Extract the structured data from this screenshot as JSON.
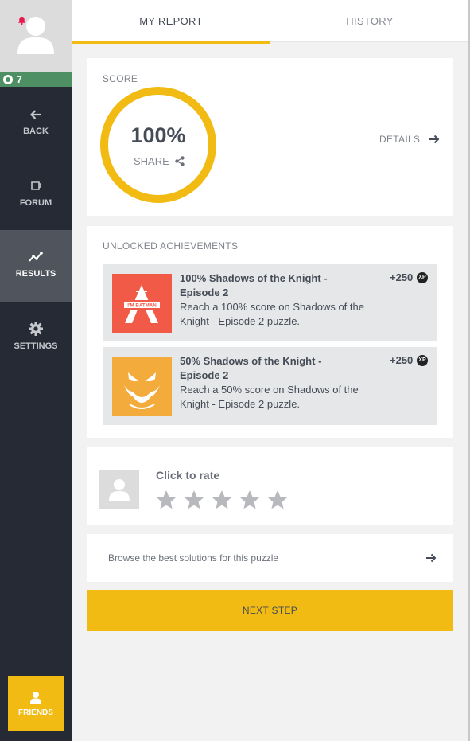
{
  "colors": {
    "accent": "#f2bb13",
    "sidebar": "#252a34",
    "level": "#4e8f63",
    "notification": "#e8174c",
    "achievement1_bg": "#f05a47",
    "achievement2_bg": "#f3ab3c"
  },
  "sidebar": {
    "level": "7",
    "nav": [
      {
        "label": "BACK",
        "icon": "arrow-left-icon"
      },
      {
        "label": "FORUM",
        "icon": "forum-icon"
      },
      {
        "label": "RESULTS",
        "icon": "chart-line-icon",
        "active": true
      },
      {
        "label": "SETTINGS",
        "icon": "gear-icon"
      }
    ],
    "friends_label": "FRIENDS"
  },
  "tabs": [
    {
      "label": "MY REPORT",
      "active": true
    },
    {
      "label": "HISTORY"
    }
  ],
  "score": {
    "label": "SCORE",
    "value": "100%",
    "progress": 1.0,
    "share_label": "SHARE",
    "details_label": "DETAILS"
  },
  "achievements": {
    "label": "UNLOCKED ACHIEVEMENTS",
    "items": [
      {
        "title": "100% Shadows of the Knight - Episode 2",
        "description": "Reach a 100% score on Shadows of the Knight - Episode 2 puzzle.",
        "xp": "+250",
        "badge": "XP",
        "image_text": "I'M BATMAN"
      },
      {
        "title": "50% Shadows of the Knight - Episode 2",
        "description": "Reach a 50% score on Shadows of the Knight - Episode 2 puzzle.",
        "xp": "+250",
        "badge": "XP"
      }
    ]
  },
  "rating": {
    "label": "Click to rate",
    "stars": 5,
    "rated": 0
  },
  "browse": {
    "label": "Browse the best solutions for this puzzle"
  },
  "next_button": {
    "label": "NEXT STEP"
  }
}
